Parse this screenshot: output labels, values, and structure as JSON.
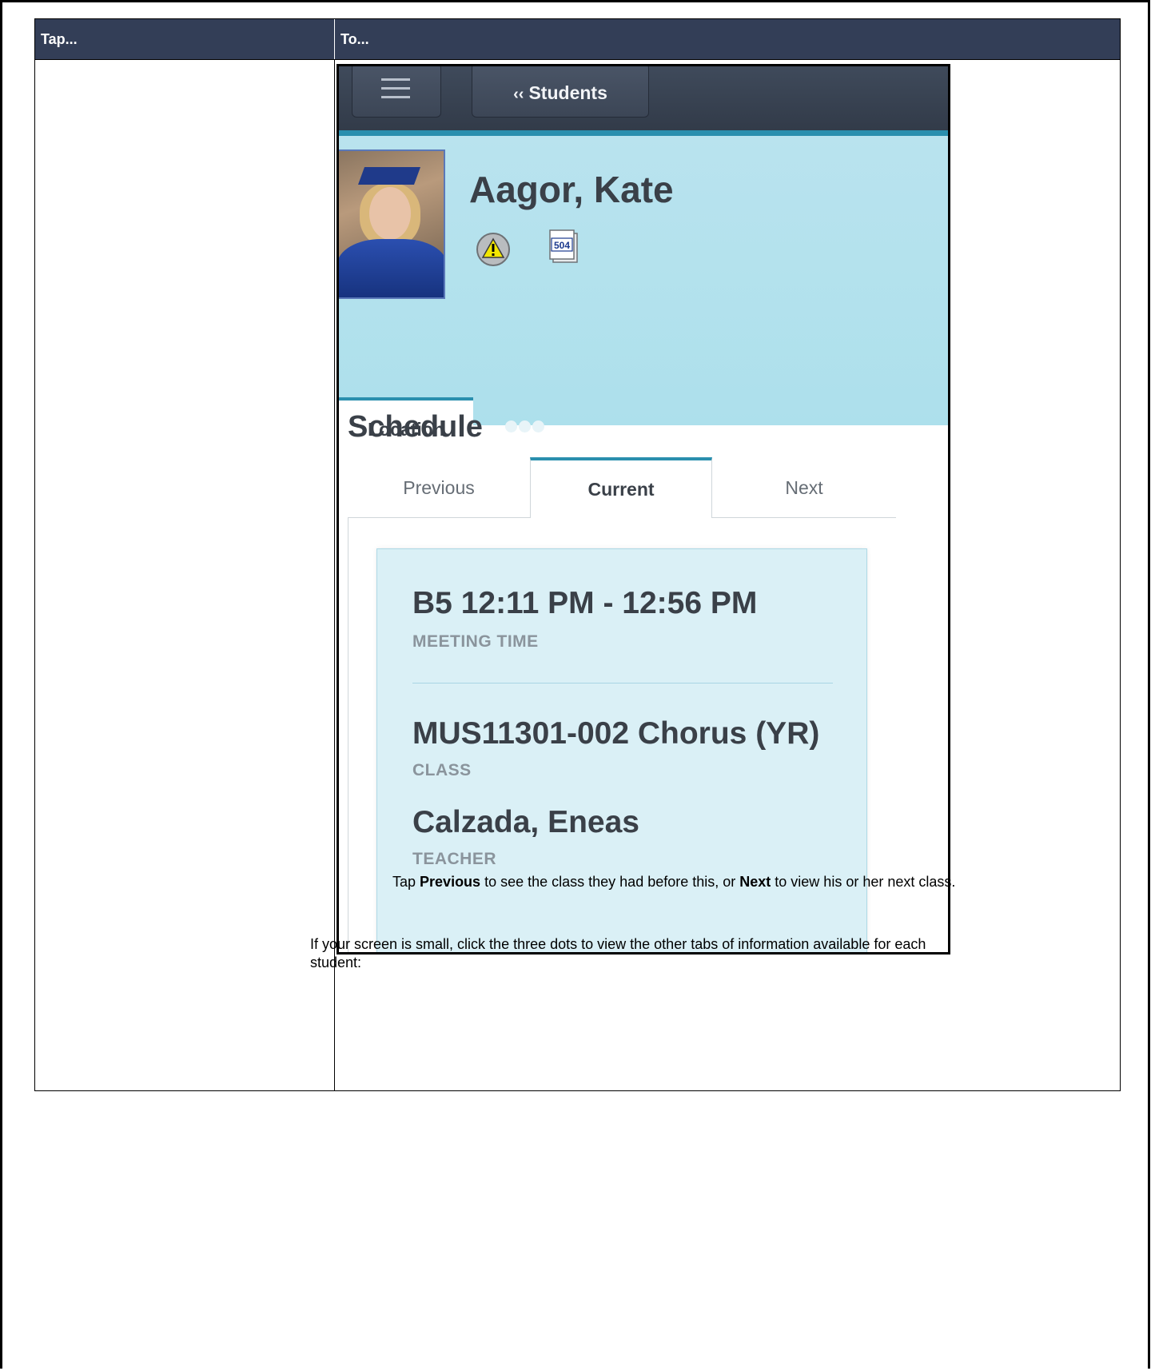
{
  "table": {
    "header_tap": "Tap...",
    "header_to": "To..."
  },
  "app": {
    "back_button_chevron": "‹‹",
    "back_button_label": "Students",
    "student_name": "Aagor, Kate",
    "alert_icon": "warning-icon",
    "plan_badge": "504",
    "tabs": {
      "location": "Location",
      "more": "more-dots-icon"
    },
    "schedule": {
      "title": "Schedule",
      "tabs": {
        "previous": "Previous",
        "current": "Current",
        "next": "Next"
      },
      "selected_tab": "Current",
      "card": {
        "meeting_time_value": "B5 12:11 PM - 12:56 PM",
        "meeting_time_label": "MEETING TIME",
        "class_value": "MUS11301-002 Chorus (YR)",
        "class_label": "CLASS",
        "teacher_value": "Calzada, Eneas",
        "teacher_label": "TEACHER"
      }
    },
    "colors": {
      "topbar": "#3a4454",
      "accent": "#2a8fae",
      "profile_bg": "#b3e1ed",
      "card_bg": "#daf0f6"
    }
  },
  "instructions": {
    "bullet_pre": "Tap ",
    "bullet_previous": "Previous",
    "bullet_mid": " to see the class they had before this, or ",
    "bullet_next": "Next",
    "bullet_post": " to view his or her next class.",
    "note": "If your screen is small, click the three dots to view the other tabs of information available for each student:"
  }
}
